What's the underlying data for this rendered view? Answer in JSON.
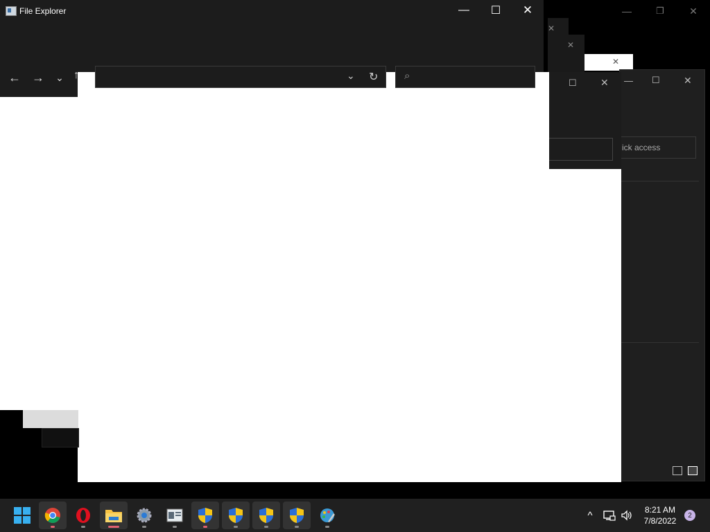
{
  "window": {
    "title": "File Explorer",
    "minimize": "—",
    "maximize": "☐",
    "close": "✕",
    "nav": {
      "back": "←",
      "forward": "→",
      "recent": "⌄",
      "up": "↑"
    },
    "address": {
      "value": "",
      "dropdown": "⌄",
      "refresh": "↻"
    },
    "search": {
      "placeholder": "",
      "icon": "⌕"
    }
  },
  "background_windows": {
    "quick_access_label": "ick access",
    "controls": {
      "minimize": "—",
      "maximize": "☐",
      "close": "✕",
      "restore": "❐"
    }
  },
  "taskbar": {
    "apps": [
      {
        "name": "start-button"
      },
      {
        "name": "chrome-app",
        "status": "open"
      },
      {
        "name": "opera-app",
        "status": "open"
      },
      {
        "name": "file-explorer-app",
        "status": "active"
      },
      {
        "name": "settings-app",
        "status": "open"
      },
      {
        "name": "control-panel-app",
        "status": "open"
      },
      {
        "name": "uac-shield-app-1",
        "status": "open"
      },
      {
        "name": "uac-shield-app-2",
        "status": "open"
      },
      {
        "name": "uac-shield-app-3",
        "status": "open"
      },
      {
        "name": "uac-shield-app-4",
        "status": "open"
      },
      {
        "name": "paint-app",
        "status": "open"
      }
    ],
    "tray": {
      "overflow": "^",
      "time": "8:21 AM",
      "date": "7/8/2022",
      "notifications": "2"
    }
  },
  "colors": {
    "accent": "#0078d4",
    "titlebar": "#1c1c1c",
    "taskbar": "#202020"
  }
}
